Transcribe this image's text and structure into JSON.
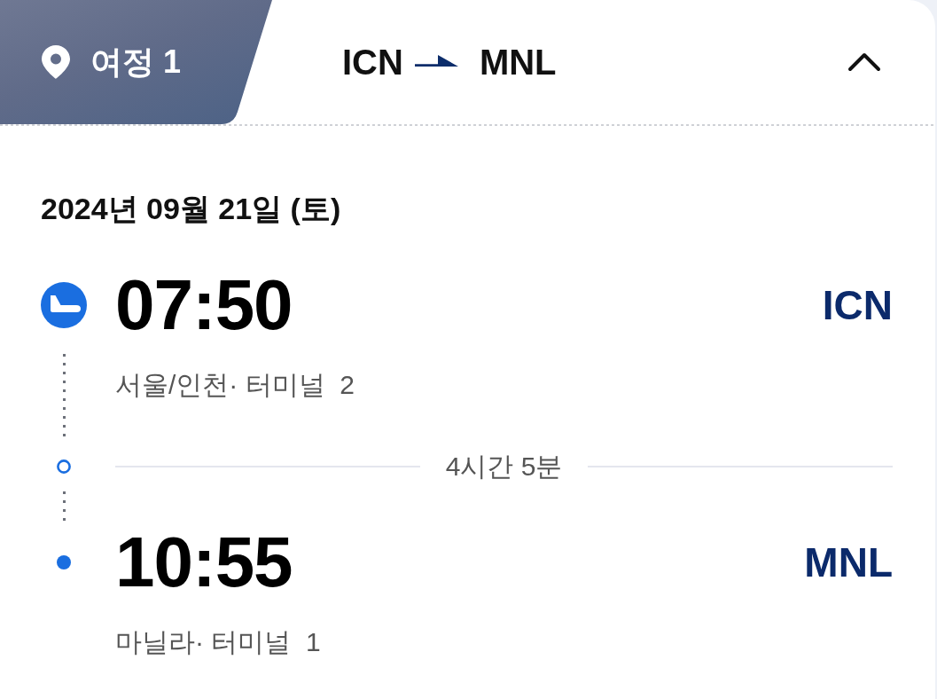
{
  "trip_tab": {
    "label": "여정 1"
  },
  "route": {
    "origin": "ICN",
    "destination": "MNL"
  },
  "details": {
    "expanded": true
  },
  "date": "2024년 09월 21일 (토)",
  "timeline": [
    {
      "kind": "departure",
      "time": "07:50",
      "airport_code": "ICN",
      "place": "서울/인천· 터미널  2"
    },
    {
      "kind": "duration",
      "label": "4시간 5분"
    },
    {
      "kind": "arrival",
      "time": "10:55",
      "airport_code": "MNL",
      "place": "마닐라· 터미널  1"
    }
  ]
}
